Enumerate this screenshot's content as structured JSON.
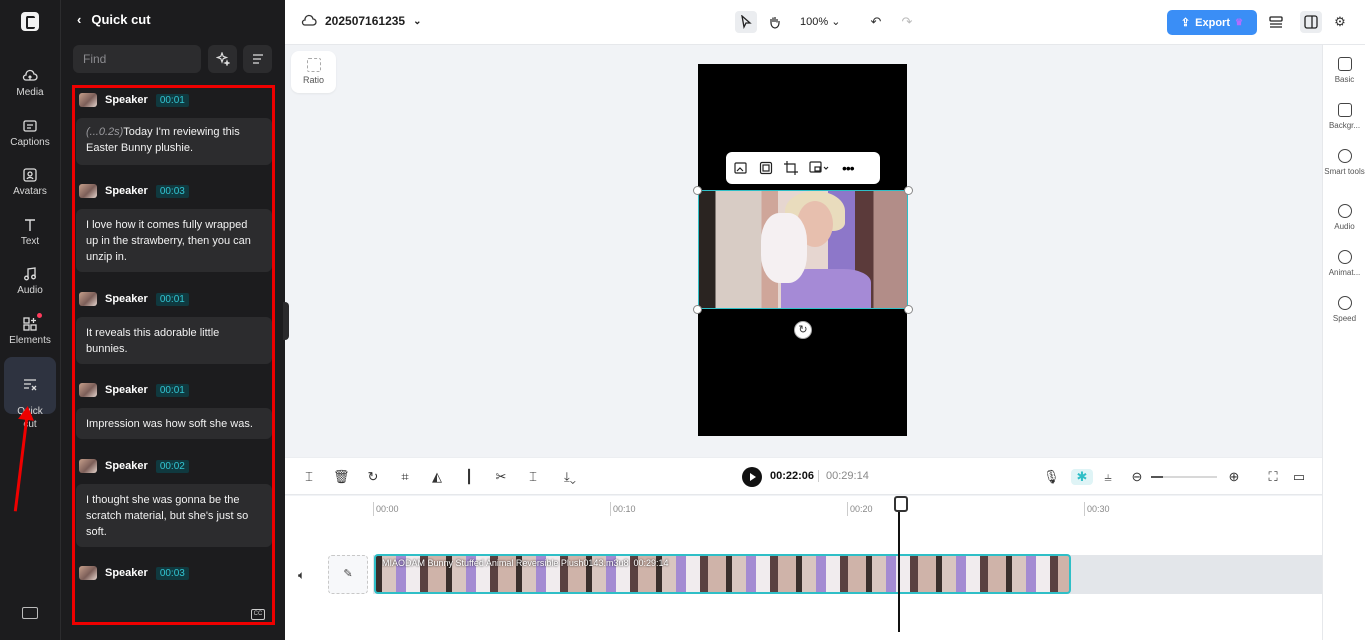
{
  "rail": {
    "items": [
      {
        "label": "Media"
      },
      {
        "label": "Captions"
      },
      {
        "label": "Avatars"
      },
      {
        "label": "Text"
      },
      {
        "label": "Audio"
      },
      {
        "label": "Elements"
      },
      {
        "label": "Quick\ncut"
      }
    ]
  },
  "panel": {
    "title": "Quick cut",
    "find_placeholder": "Find",
    "entries": [
      {
        "speaker": "Speaker",
        "time": "00:01",
        "pause": "(...0.2s)",
        "text": "Today I'm reviewing this Easter Bunny plushie."
      },
      {
        "speaker": "Speaker",
        "time": "00:03",
        "pause": "",
        "text": "I love how it comes fully wrapped up in the strawberry, then you can unzip in."
      },
      {
        "speaker": "Speaker",
        "time": "00:01",
        "pause": "",
        "text": "It reveals this adorable little bunnies."
      },
      {
        "speaker": "Speaker",
        "time": "00:01",
        "pause": "",
        "text": "Impression was how soft she was."
      },
      {
        "speaker": "Speaker",
        "time": "00:02",
        "pause": "",
        "text": "I thought she was gonna be the scratch material, but she's just so soft."
      },
      {
        "speaker": "Speaker",
        "time": "00:03",
        "pause": "",
        "text": ""
      }
    ],
    "cc_label": "CC"
  },
  "topbar": {
    "project_name": "202507161235",
    "zoom": "100%",
    "export_label": "Export"
  },
  "canvas": {
    "ratio_label": "Ratio"
  },
  "right_sidebar": {
    "items": [
      {
        "label": "Basic"
      },
      {
        "label": "Backgr..."
      },
      {
        "label": "Smart tools"
      },
      {
        "label": "Audio"
      },
      {
        "label": "Animat..."
      },
      {
        "label": "Speed"
      }
    ]
  },
  "timeline": {
    "current_time": "00:22:06",
    "duration": "00:29:14",
    "ruler": [
      "00:00",
      "00:10",
      "00:20",
      "00:30"
    ],
    "clip_name": "MIAODAM Bunny Stuffed Animal Reversible Plush0143.m3u8",
    "clip_duration": "00:29:14"
  },
  "colors": {
    "accent": "#2fbfc7",
    "export": "#3a8ef6",
    "highlight_box": "#ee0000"
  }
}
